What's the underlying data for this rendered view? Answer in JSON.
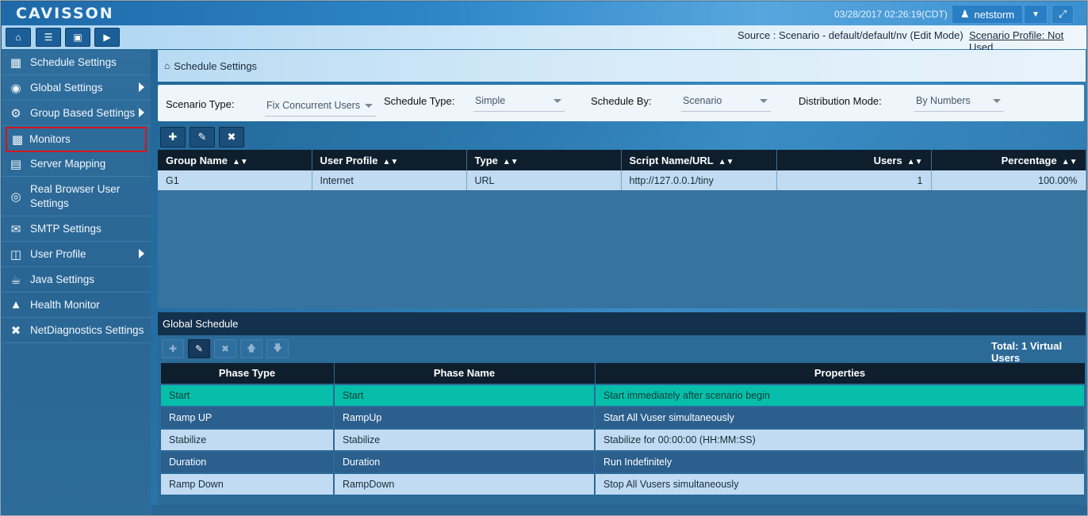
{
  "header": {
    "logo": "CAVISSON",
    "datetime": "03/28/2017 02:26:19(CDT)",
    "user": "netstorm"
  },
  "toolbar": {
    "source": "Source : Scenario - default/default/nv (Edit Mode)",
    "profile": "Scenario Profile: Not Used"
  },
  "sidebar": {
    "items": [
      {
        "label": "Schedule Settings",
        "icon": "calendar-icon"
      },
      {
        "label": "Global Settings",
        "icon": "globe-icon"
      },
      {
        "label": "Group Based Settings",
        "icon": "gear-icon"
      },
      {
        "label": "Monitors",
        "icon": "monitor-icon"
      },
      {
        "label": "Server Mapping",
        "icon": "server-icon"
      },
      {
        "label": "Real Browser User Settings",
        "icon": "browser-icon"
      },
      {
        "label": "SMTP Settings",
        "icon": "envelope-icon"
      },
      {
        "label": "User Profile",
        "icon": "folder-icon"
      },
      {
        "label": "Java Settings",
        "icon": "coffee-icon"
      },
      {
        "label": "Health Monitor",
        "icon": "chart-icon"
      },
      {
        "label": "NetDiagnostics Settings",
        "icon": "tools-icon"
      }
    ]
  },
  "breadcrumb": "Schedule Settings",
  "filters": {
    "scenario_type_label": "Scenario Type:",
    "scenario_type_value": "Fix Concurrent Users",
    "schedule_type_label": "Schedule Type:",
    "schedule_type_value": "Simple",
    "schedule_by_label": "Schedule By:",
    "schedule_by_value": "Scenario",
    "distribution_label": "Distribution Mode:",
    "distribution_value": "By Numbers"
  },
  "groups": {
    "columns": [
      "Group Name",
      "User Profile",
      "Type",
      "Script Name/URL",
      "Users",
      "Percentage"
    ],
    "rows": [
      [
        "G1",
        "Internet",
        "URL",
        "http://127.0.0.1/tiny",
        "1",
        "100.00%"
      ]
    ]
  },
  "global_schedule": {
    "title": "Global Schedule",
    "total": "Total: 1 Virtual Users",
    "columns": [
      "Phase Type",
      "Phase Name",
      "Properties"
    ],
    "rows": [
      [
        "Start",
        "Start",
        "Start immediately after scenario begin"
      ],
      [
        "Ramp UP",
        "RampUp",
        "Start All Vuser simultaneously"
      ],
      [
        "Stabilize",
        "Stabilize",
        "Stabilize for 00:00:00 (HH:MM:SS)"
      ],
      [
        "Duration",
        "Duration",
        "Run Indefinitely"
      ],
      [
        "Ramp Down",
        "RampDown",
        "Stop All Vusers simultaneously"
      ]
    ]
  }
}
